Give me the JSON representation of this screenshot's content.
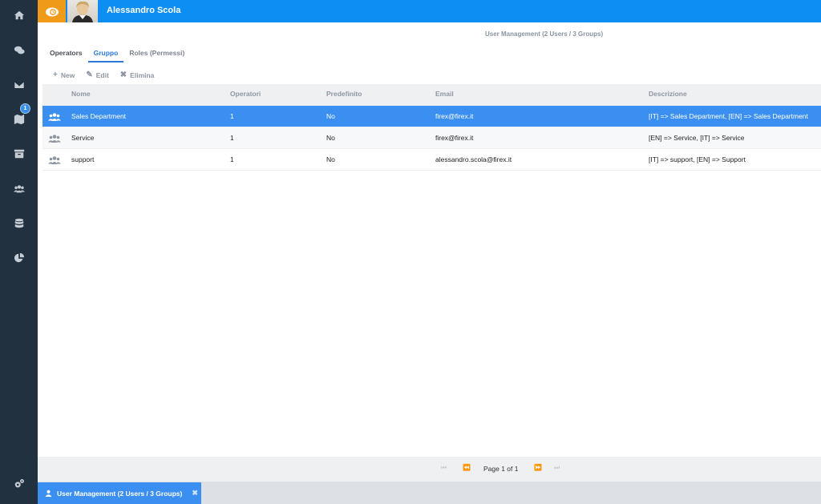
{
  "header": {
    "user_name": "Alessandro Scola"
  },
  "sidebar": {
    "items": [
      {
        "icon": "home-icon"
      },
      {
        "icon": "chat-icon"
      },
      {
        "icon": "mail-icon"
      },
      {
        "icon": "map-icon",
        "badge": "1"
      },
      {
        "icon": "archive-icon"
      },
      {
        "icon": "users-icon"
      },
      {
        "icon": "database-icon"
      },
      {
        "icon": "pie-chart-icon"
      },
      {
        "icon": "settings-icon"
      }
    ]
  },
  "page": {
    "heading": "User Management (2 Users / 3 Groups)"
  },
  "tabs": [
    {
      "label": "Operators"
    },
    {
      "label": "Gruppo"
    },
    {
      "label": "Roles (Permessi)"
    }
  ],
  "toolbar": {
    "new_label": "New",
    "edit_label": "Edit",
    "delete_label": "Elimina"
  },
  "grid": {
    "columns": [
      "Nome",
      "Operatori",
      "Predefinito",
      "Email",
      "Descrizione"
    ],
    "rows": [
      {
        "name": "Sales Department",
        "operators": "1",
        "default": "No",
        "email": "firex@firex.it",
        "description": "[IT] => Sales Department, [EN] => Sales Department"
      },
      {
        "name": "Service",
        "operators": "1",
        "default": "No",
        "email": "firex@firex.it",
        "description": "[EN] => Service, [IT] => Service"
      },
      {
        "name": "support",
        "operators": "1",
        "default": "No",
        "email": "alessandro.scola@firex.it",
        "description": "[IT] => support, [EN] => Support"
      }
    ]
  },
  "pager": {
    "text": "Page 1 of 1"
  },
  "bottom_tab": {
    "label": "User Management (2 Users / 3 Groups)"
  },
  "colors": {
    "accent": "#0d8ef2",
    "selected_row": "#3b8ff0",
    "sidebar": "#22313f",
    "logo": "#f09a1a"
  }
}
